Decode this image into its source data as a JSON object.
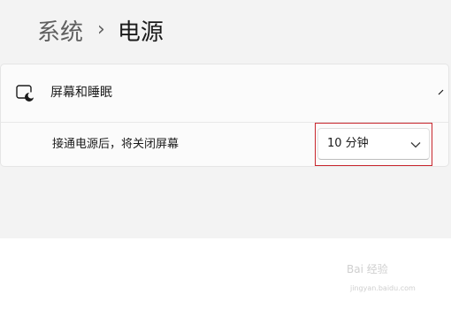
{
  "breadcrumb": {
    "parent": "系统",
    "separator": "›",
    "current": "电源"
  },
  "screen_sleep": {
    "title": "屏幕和睡眠",
    "expanded": true,
    "setting": {
      "label": "接通电源后，将关闭屏幕",
      "selected_value": "10 分钟"
    }
  },
  "watermark": {
    "logo": "Bai 经验",
    "url": "jingyan.baidu.com"
  },
  "colors": {
    "pane_background": "#f3f3f3",
    "card_background": "#fbfbfb",
    "highlight": "#c8262d"
  },
  "icons": {
    "screen_sleep": "screen-moon-icon",
    "collapse": "chevron-up-icon",
    "dropdown": "chevron-down-icon"
  }
}
